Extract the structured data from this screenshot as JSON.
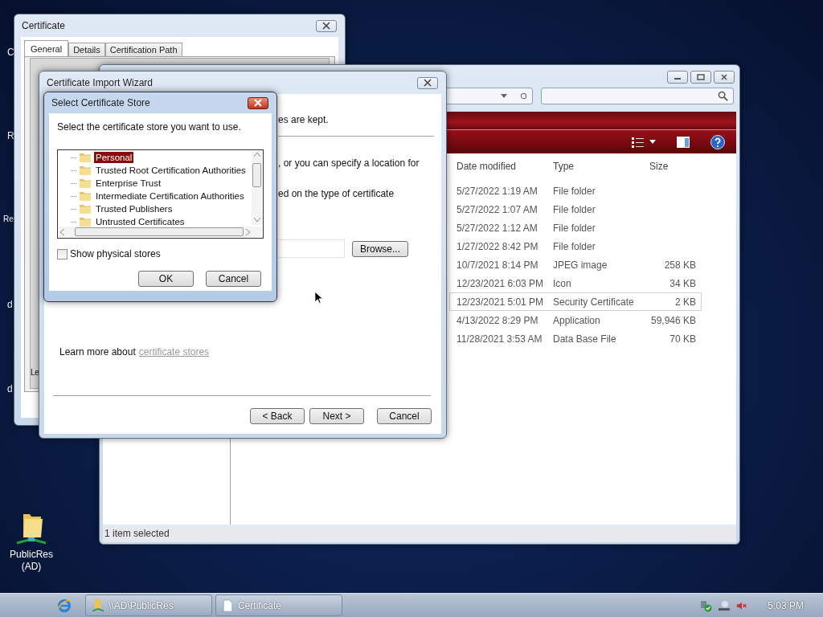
{
  "desktop": {
    "cut_labels": [
      "C",
      "R",
      "Re",
      "d",
      "d"
    ],
    "icons": [
      {
        "label": "PublicRes (AD)"
      }
    ]
  },
  "certificate_window": {
    "title": "Certificate",
    "tabs": [
      {
        "label": "General",
        "selected": true
      },
      {
        "label": "Details",
        "selected": false
      },
      {
        "label": "Certification Path",
        "selected": false
      }
    ],
    "cut_text": "Le"
  },
  "explorer": {
    "columns": [
      "Date modified",
      "Type",
      "Size"
    ],
    "rows": [
      {
        "date": "5/27/2022 1:19 AM",
        "type": "File folder",
        "size": "",
        "selected": false
      },
      {
        "date": "5/27/2022 1:07 AM",
        "type": "File folder",
        "size": "",
        "selected": false
      },
      {
        "date": "5/27/2022 1:12 AM",
        "type": "File folder",
        "size": "",
        "selected": false
      },
      {
        "date": "1/27/2022 8:42 PM",
        "type": "File folder",
        "size": "",
        "selected": false
      },
      {
        "date": "10/7/2021 8:14 PM",
        "type": "JPEG image",
        "size": "258 KB",
        "selected": false
      },
      {
        "date": "12/23/2021 6:03 PM",
        "type": "Icon",
        "size": "34 KB",
        "selected": false
      },
      {
        "date": "12/23/2021 5:01 PM",
        "type": "Security Certificate",
        "size": "2 KB",
        "selected": true
      },
      {
        "date": "4/13/2022 8:29 PM",
        "type": "Application",
        "size": "59,946 KB",
        "selected": false
      },
      {
        "date": "11/28/2021 3:53 AM",
        "type": "Data Base File",
        "size": "70 KB",
        "selected": false
      }
    ],
    "status": "1 item selected"
  },
  "wizard": {
    "title": "Certificate Import Wizard",
    "fragments": [
      "es are kept.",
      ", or you can specify a location for",
      "ed on the type of certificate"
    ],
    "browse": "Browse...",
    "learn_more": "Learn more about",
    "link": "certificate stores",
    "buttons": [
      "< Back",
      "Next >",
      "Cancel"
    ]
  },
  "store_dialog": {
    "title": "Select Certificate Store",
    "prompt": "Select the certificate store you want to use.",
    "stores": [
      {
        "label": "Personal",
        "selected": true
      },
      {
        "label": "Trusted Root Certification Authorities",
        "selected": false
      },
      {
        "label": "Enterprise Trust",
        "selected": false
      },
      {
        "label": "Intermediate Certification Authorities",
        "selected": false
      },
      {
        "label": "Trusted Publishers",
        "selected": false
      },
      {
        "label": "Untrusted Certificates",
        "selected": false
      }
    ],
    "show_physical": {
      "label": "Show physical stores",
      "checked": false
    },
    "buttons": [
      "OK",
      "Cancel"
    ]
  },
  "taskbar": {
    "buttons": [
      {
        "label": "\\\\AD\\PublicRes",
        "kind": "folder"
      },
      {
        "label": "Certificate",
        "kind": "document"
      }
    ],
    "clock": "5:03 PM"
  }
}
